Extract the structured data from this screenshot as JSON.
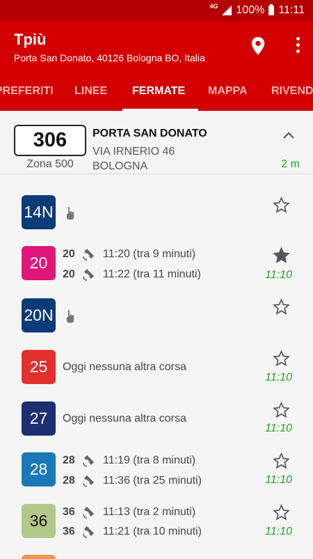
{
  "status_bar": {
    "network": "4G",
    "battery": "100%",
    "time": "11:11"
  },
  "app_bar": {
    "title": "Tpiù",
    "subtitle": "Porta San Donato, 40126 Bologna BO, Italia",
    "location_icon": "location-pin-icon",
    "menu_icon": "more-vert-icon"
  },
  "tabs": [
    {
      "label": "PREFERITI",
      "active": false
    },
    {
      "label": "LINEE",
      "active": false
    },
    {
      "label": "FERMATE",
      "active": true
    },
    {
      "label": "MAPPA",
      "active": false
    },
    {
      "label": "RIVENDITE",
      "active": false
    }
  ],
  "stop": {
    "code": "306",
    "zone": "Zona 500",
    "name": "PORTA SAN DONATO",
    "address": "VIA IRNERIO 46",
    "city": "BOLOGNA",
    "distance": "2 m"
  },
  "lines": [
    {
      "line": "14N",
      "color": "#0b3b78",
      "text_color": "#ffffff",
      "favorite": false,
      "on_request": true,
      "departures": [],
      "no_more_text": "",
      "updated": ""
    },
    {
      "line": "20",
      "color": "#e0177a",
      "text_color": "#ffffff",
      "favorite": true,
      "on_request": false,
      "departures": [
        {
          "line": "20",
          "time": "11:20 (tra 9 minuti)"
        },
        {
          "line": "20",
          "time": "11:22 (tra 11 minuti)"
        }
      ],
      "no_more_text": "",
      "updated": "11:10"
    },
    {
      "line": "20N",
      "color": "#0b3b78",
      "text_color": "#ffffff",
      "favorite": false,
      "on_request": true,
      "departures": [],
      "no_more_text": "",
      "updated": ""
    },
    {
      "line": "25",
      "color": "#e1302d",
      "text_color": "#ffffff",
      "favorite": false,
      "on_request": false,
      "departures": [],
      "no_more_text": "Oggi nessuna altra corsa",
      "updated": "11:10"
    },
    {
      "line": "27",
      "color": "#1c2f72",
      "text_color": "#ffffff",
      "favorite": false,
      "on_request": false,
      "departures": [],
      "no_more_text": "Oggi nessuna altra corsa",
      "updated": "11:10"
    },
    {
      "line": "28",
      "color": "#1a78b8",
      "text_color": "#ffffff",
      "favorite": false,
      "on_request": false,
      "departures": [
        {
          "line": "28",
          "time": "11:19 (tra 8 minuti)"
        },
        {
          "line": "28",
          "time": "11:36 (tra 25 minuti)"
        }
      ],
      "no_more_text": "",
      "updated": "11:10"
    },
    {
      "line": "36",
      "color": "#b3c78a",
      "text_color": "#111111",
      "favorite": false,
      "on_request": false,
      "departures": [
        {
          "line": "36",
          "time": "11:13 (tra 2 minuti)"
        },
        {
          "line": "36",
          "time": "11:21 (tra 10 minuti)"
        }
      ],
      "no_more_text": "",
      "updated": "11:10"
    }
  ],
  "colors": {
    "primary": "#d20000",
    "status_bar": "#b50000",
    "realtime": "#21a521"
  }
}
